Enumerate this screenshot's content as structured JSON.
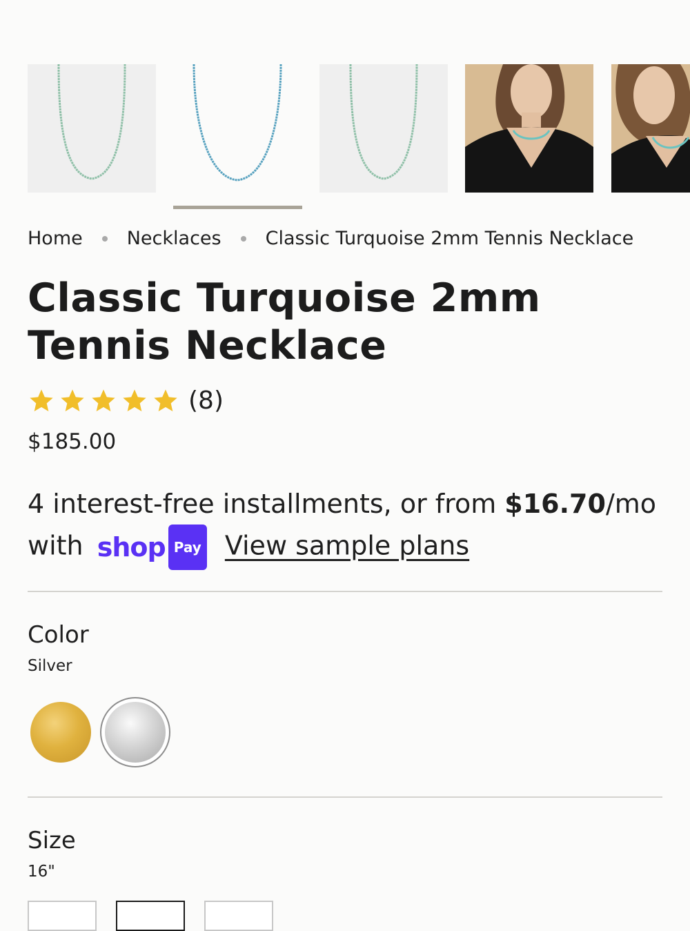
{
  "gallery": {
    "thumbnails": [
      {
        "name": "necklace-thumb-1",
        "alt": "Necklace front view"
      },
      {
        "name": "necklace-thumb-2",
        "alt": "Necklace front view selected"
      },
      {
        "name": "necklace-thumb-3",
        "alt": "Necklace front view"
      },
      {
        "name": "model-thumb-1",
        "alt": "Model wearing necklace"
      },
      {
        "name": "model-thumb-2",
        "alt": "Model wearing necklace"
      }
    ],
    "selected_index": 1
  },
  "breadcrumb": {
    "home": "Home",
    "category": "Necklaces",
    "current": "Classic Turquoise 2mm Tennis Necklace"
  },
  "product": {
    "title_line1": "Classic Turquoise 2mm",
    "title_line2": "Tennis Necklace",
    "rating": 5,
    "rating_max": 5,
    "review_count": "(8)",
    "price": "$185.00"
  },
  "installments": {
    "text_before": "4 interest-free installments, or from ",
    "amount": "$16.70",
    "text_after": "/mo",
    "with": "with",
    "shop_word": "shop",
    "pay_badge": "Pay",
    "link_label": "View sample plans"
  },
  "options": {
    "color": {
      "label": "Color",
      "value": "Silver",
      "swatches": [
        {
          "name": "Gold",
          "color": "#e0b23f"
        },
        {
          "name": "Silver",
          "color": "#d4d4d4",
          "selected": true
        }
      ]
    },
    "size": {
      "label": "Size",
      "value": "16\""
    }
  },
  "colors": {
    "star": "#f1be2a",
    "shop_pay_purple": "#5a31f4",
    "divider": "#d4d3cf"
  }
}
